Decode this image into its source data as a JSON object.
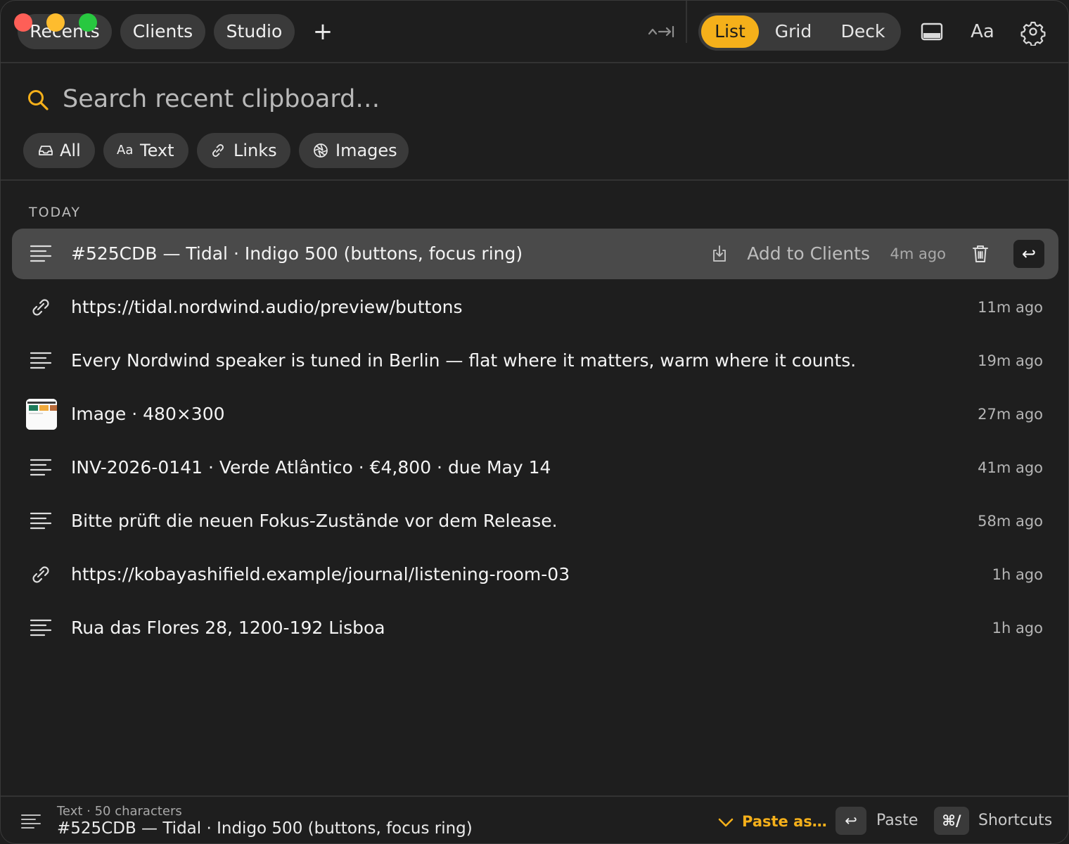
{
  "window": {
    "tabs": [
      "Recents",
      "Clients",
      "Studio"
    ],
    "add_tab_label": "+",
    "collapse_label": "^→|"
  },
  "view_switch": {
    "options": [
      "List",
      "Grid",
      "Deck"
    ],
    "selected": "List",
    "accent": "#f5b01a"
  },
  "toolbar": {
    "font_label": "Aa"
  },
  "search": {
    "placeholder": "Search recent clipboard…",
    "value": ""
  },
  "filters": [
    {
      "label": "All",
      "icon": "inbox-icon"
    },
    {
      "label": "Text",
      "icon_text": "Aa",
      "icon": "font-icon"
    },
    {
      "label": "Links",
      "icon": "link-icon"
    },
    {
      "label": "Images",
      "icon": "aperture-icon"
    }
  ],
  "list": {
    "section": "TODAY",
    "items": [
      {
        "type": "text",
        "text": "#525CDB — Tidal · Indigo 500 (buttons, focus ring)",
        "time": "4m ago",
        "selected": true
      },
      {
        "type": "link",
        "text": "https://tidal.nordwind.audio/preview/buttons",
        "time": "11m ago"
      },
      {
        "type": "text",
        "text": "Every Nordwind speaker is tuned in Berlin — flat where it matters, warm where it counts.",
        "time": "19m ago"
      },
      {
        "type": "image",
        "text": "Image · 480×300",
        "time": "27m ago"
      },
      {
        "type": "text",
        "text": "INV-2026-0141 · Verde Atlântico · €4,800 · due May 14",
        "time": "41m ago"
      },
      {
        "type": "text",
        "text": "Bitte prüft die neuen Fokus-Zustände vor dem Release.",
        "time": "58m ago"
      },
      {
        "type": "link",
        "text": "https://kobayashifield.example/journal/listening-room-03",
        "time": "1h ago"
      },
      {
        "type": "text",
        "text": "Rua das Flores 28, 1200-192 Lisboa",
        "time": "1h ago"
      }
    ],
    "selected_actions": {
      "add_to": "Add to Clients",
      "enter_key": "↩"
    }
  },
  "footer": {
    "meta": "Text · 50 characters",
    "preview": "#525CDB — Tidal · Indigo 500 (buttons, focus ring)",
    "paste_as": "Paste as…",
    "paste_key": "↩",
    "paste_label": "Paste",
    "shortcuts_key": "⌘/",
    "shortcuts_label": "Shortcuts"
  }
}
